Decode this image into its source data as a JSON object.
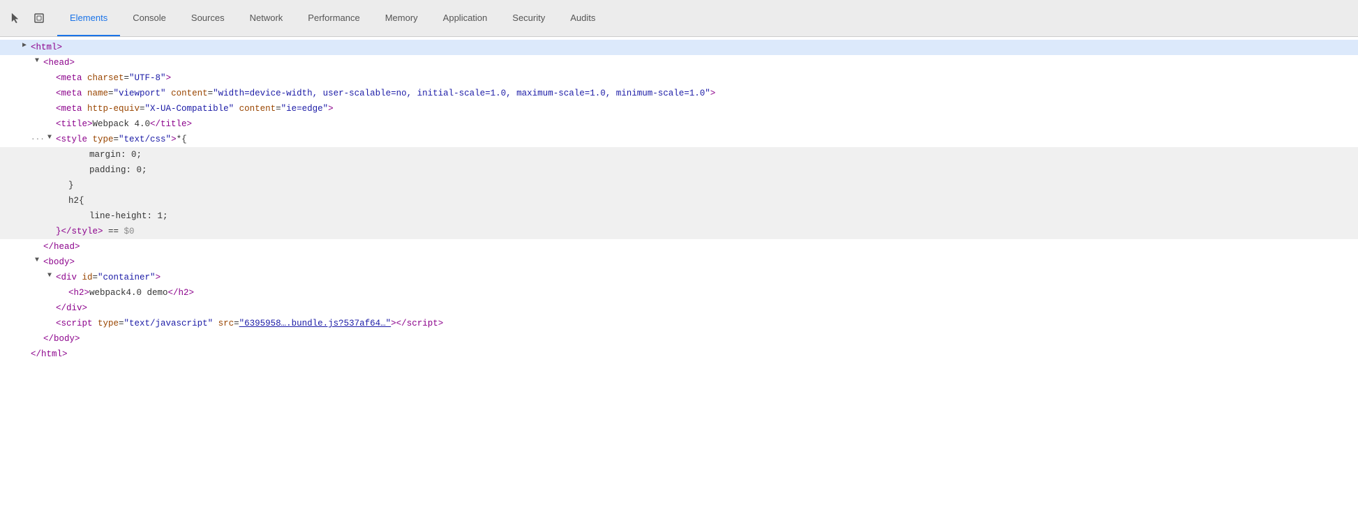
{
  "tabs": [
    {
      "id": "elements",
      "label": "Elements",
      "active": true
    },
    {
      "id": "console",
      "label": "Console",
      "active": false
    },
    {
      "id": "sources",
      "label": "Sources",
      "active": false
    },
    {
      "id": "network",
      "label": "Network",
      "active": false
    },
    {
      "id": "performance",
      "label": "Performance",
      "active": false
    },
    {
      "id": "memory",
      "label": "Memory",
      "active": false
    },
    {
      "id": "application",
      "label": "Application",
      "active": false
    },
    {
      "id": "security",
      "label": "Security",
      "active": false
    },
    {
      "id": "audits",
      "label": "Audits",
      "active": false
    }
  ],
  "icons": {
    "cursor": "⬚",
    "box": "⬜"
  },
  "tree": {
    "lines": [
      {
        "id": "html-open",
        "indent": 0,
        "triangle": "▶",
        "selected": true,
        "content": [
          {
            "type": "tag",
            "text": "<html>"
          }
        ]
      },
      {
        "id": "head-open",
        "indent": 1,
        "triangle": "▼",
        "selected": false,
        "content": [
          {
            "type": "tag",
            "text": "<head>"
          }
        ]
      },
      {
        "id": "meta-charset",
        "indent": 2,
        "triangle": null,
        "selected": false,
        "content": [
          {
            "type": "tag",
            "text": "<meta "
          },
          {
            "type": "attr-name",
            "text": "charset"
          },
          {
            "type": "text",
            "text": "="
          },
          {
            "type": "attr-value",
            "text": "\"UTF-8\""
          },
          {
            "type": "tag",
            "text": ">"
          }
        ]
      },
      {
        "id": "meta-viewport",
        "indent": 2,
        "triangle": null,
        "selected": false,
        "content": [
          {
            "type": "tag",
            "text": "<meta "
          },
          {
            "type": "attr-name",
            "text": "name"
          },
          {
            "type": "text",
            "text": "="
          },
          {
            "type": "attr-value",
            "text": "\"viewport\""
          },
          {
            "type": "text",
            "text": " "
          },
          {
            "type": "attr-name",
            "text": "content"
          },
          {
            "type": "text",
            "text": "="
          },
          {
            "type": "attr-value",
            "text": "\"width=device-width, user-scalable=no, initial-scale=1.0, maximum-scale=1.0, minimum-scale=1.0\""
          },
          {
            "type": "tag",
            "text": ">"
          }
        ]
      },
      {
        "id": "meta-httpequiv",
        "indent": 2,
        "triangle": null,
        "selected": false,
        "content": [
          {
            "type": "tag",
            "text": "<meta "
          },
          {
            "type": "attr-name",
            "text": "http-equiv"
          },
          {
            "type": "text",
            "text": "="
          },
          {
            "type": "attr-value",
            "text": "\"X-UA-Compatible\""
          },
          {
            "type": "text",
            "text": " "
          },
          {
            "type": "attr-name",
            "text": "content"
          },
          {
            "type": "text",
            "text": "="
          },
          {
            "type": "attr-value",
            "text": "\"ie=edge\""
          },
          {
            "type": "tag",
            "text": ">"
          }
        ]
      },
      {
        "id": "title",
        "indent": 2,
        "triangle": null,
        "selected": false,
        "content": [
          {
            "type": "tag",
            "text": "<title>"
          },
          {
            "type": "text-content",
            "text": "Webpack 4.0"
          },
          {
            "type": "tag",
            "text": "</title>"
          }
        ]
      },
      {
        "id": "style-open",
        "indent": 2,
        "triangle": "▼",
        "selected": false,
        "hasDots": true,
        "collapsed": false,
        "content": [
          {
            "type": "tag",
            "text": "<style "
          },
          {
            "type": "attr-name",
            "text": "type"
          },
          {
            "type": "text",
            "text": "="
          },
          {
            "type": "attr-value",
            "text": "\"text/css\""
          },
          {
            "type": "tag",
            "text": ">"
          },
          {
            "type": "text-content",
            "text": "*{"
          }
        ]
      },
      {
        "id": "style-margin",
        "indent": 3,
        "triangle": null,
        "selected": false,
        "isStyleContent": true,
        "content": [
          {
            "type": "text-content",
            "text": "    margin: 0;"
          }
        ]
      },
      {
        "id": "style-padding",
        "indent": 3,
        "triangle": null,
        "selected": false,
        "isStyleContent": true,
        "content": [
          {
            "type": "text-content",
            "text": "    padding: 0;"
          }
        ]
      },
      {
        "id": "style-brace-close",
        "indent": 3,
        "triangle": null,
        "selected": false,
        "isStyleContent": true,
        "content": [
          {
            "type": "text-content",
            "text": "}"
          }
        ]
      },
      {
        "id": "style-h2",
        "indent": 3,
        "triangle": null,
        "selected": false,
        "isStyleContent": true,
        "content": [
          {
            "type": "text-content",
            "text": "h2{"
          }
        ]
      },
      {
        "id": "style-lineheight",
        "indent": 3,
        "triangle": null,
        "selected": false,
        "isStyleContent": true,
        "content": [
          {
            "type": "text-content",
            "text": "    line-height: 1;"
          }
        ]
      },
      {
        "id": "style-close",
        "indent": 2,
        "triangle": null,
        "selected": false,
        "isStyleContent": true,
        "content": [
          {
            "type": "tag",
            "text": "}"
          },
          {
            "type": "tag",
            "text": "</style>"
          },
          {
            "type": "text-content",
            "text": " == "
          },
          {
            "type": "comment",
            "text": "$0"
          }
        ]
      },
      {
        "id": "head-close",
        "indent": 1,
        "triangle": null,
        "selected": false,
        "content": [
          {
            "type": "tag",
            "text": "</head>"
          }
        ]
      },
      {
        "id": "body-open",
        "indent": 1,
        "triangle": "▼",
        "selected": false,
        "content": [
          {
            "type": "tag",
            "text": "<body>"
          }
        ]
      },
      {
        "id": "div-open",
        "indent": 2,
        "triangle": "▼",
        "selected": false,
        "content": [
          {
            "type": "tag",
            "text": "<div "
          },
          {
            "type": "attr-name",
            "text": "id"
          },
          {
            "type": "text",
            "text": "="
          },
          {
            "type": "attr-value",
            "text": "\"container\""
          },
          {
            "type": "tag",
            "text": ">"
          }
        ]
      },
      {
        "id": "h2",
        "indent": 3,
        "triangle": null,
        "selected": false,
        "content": [
          {
            "type": "tag",
            "text": "<h2>"
          },
          {
            "type": "text-content",
            "text": "webpack4.0 demo"
          },
          {
            "type": "tag",
            "text": "</h2>"
          }
        ]
      },
      {
        "id": "div-close",
        "indent": 2,
        "triangle": null,
        "selected": false,
        "content": [
          {
            "type": "tag",
            "text": "</div>"
          }
        ]
      },
      {
        "id": "script",
        "indent": 2,
        "triangle": null,
        "selected": false,
        "content": [
          {
            "type": "tag",
            "text": "<script "
          },
          {
            "type": "attr-name",
            "text": "type"
          },
          {
            "type": "text",
            "text": "="
          },
          {
            "type": "attr-value",
            "text": "\"text/javascript\""
          },
          {
            "type": "text",
            "text": " "
          },
          {
            "type": "attr-name",
            "text": "src"
          },
          {
            "type": "text",
            "text": "="
          },
          {
            "type": "attr-value-link",
            "text": "\"6395958….bundle.js?537af64…\""
          },
          {
            "type": "tag",
            "text": "></"
          },
          {
            "type": "tag",
            "text": "script>"
          }
        ]
      },
      {
        "id": "body-close",
        "indent": 1,
        "triangle": null,
        "selected": false,
        "content": [
          {
            "type": "tag",
            "text": "</body>"
          }
        ]
      },
      {
        "id": "html-close",
        "indent": 0,
        "triangle": null,
        "selected": false,
        "content": [
          {
            "type": "tag",
            "text": "</html>"
          }
        ]
      }
    ]
  }
}
